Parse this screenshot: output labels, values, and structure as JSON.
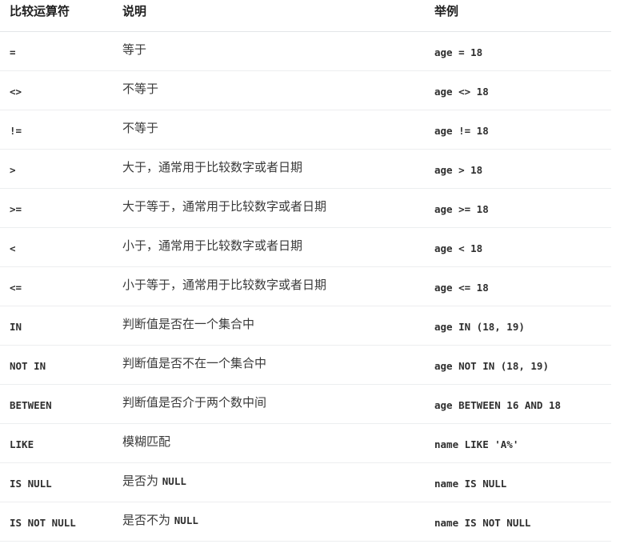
{
  "headers": [
    "比较运算符",
    "说明",
    "举例"
  ],
  "rows": [
    {
      "op": "=",
      "desc": "等于",
      "desc_code": "",
      "example": "age = 18"
    },
    {
      "op": "<>",
      "desc": "不等于",
      "desc_code": "",
      "example": "age <> 18"
    },
    {
      "op": "!=",
      "desc": "不等于",
      "desc_code": "",
      "example": "age != 18"
    },
    {
      "op": ">",
      "desc": "大于，通常用于比较数字或者日期",
      "desc_code": "",
      "example": "age > 18"
    },
    {
      "op": ">=",
      "desc": "大于等于，通常用于比较数字或者日期",
      "desc_code": "",
      "example": "age >= 18"
    },
    {
      "op": "<",
      "desc": "小于，通常用于比较数字或者日期",
      "desc_code": "",
      "example": "age < 18"
    },
    {
      "op": "<=",
      "desc": "小于等于，通常用于比较数字或者日期",
      "desc_code": "",
      "example": "age <= 18"
    },
    {
      "op": "IN",
      "desc": "判断值是否在一个集合中",
      "desc_code": "",
      "example": "age IN (18, 19)"
    },
    {
      "op": "NOT IN",
      "desc": "判断值是否不在一个集合中",
      "desc_code": "",
      "example": "age NOT IN (18, 19)"
    },
    {
      "op": "BETWEEN",
      "desc": "判断值是否介于两个数中间",
      "desc_code": "",
      "example": "age BETWEEN 16 AND 18"
    },
    {
      "op": "LIKE",
      "desc": "模糊匹配",
      "desc_code": "",
      "example": "name LIKE 'A%'"
    },
    {
      "op": "IS NULL",
      "desc": "是否为 ",
      "desc_code": "NULL",
      "example": "name IS NULL"
    },
    {
      "op": "IS NOT NULL",
      "desc": "是否不为 ",
      "desc_code": "NULL",
      "example": "name IS NOT NULL"
    }
  ]
}
